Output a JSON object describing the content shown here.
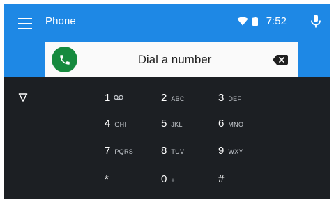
{
  "app": {
    "title": "Phone"
  },
  "status": {
    "time": "7:52",
    "icons": [
      "wifi-icon",
      "battery-icon"
    ]
  },
  "header": {
    "menu_icon": "menu-icon",
    "mic_icon": "mic-icon"
  },
  "dialer": {
    "prompt": "Dial a number",
    "call_icon": "phone-icon",
    "backspace_icon": "backspace-icon",
    "collapse_icon": "collapse-triangle-icon"
  },
  "keypad": {
    "rows": [
      [
        {
          "digit": "1",
          "letters": ""
        },
        {
          "digit": "2",
          "letters": "ABC"
        },
        {
          "digit": "3",
          "letters": "DEF"
        }
      ],
      [
        {
          "digit": "4",
          "letters": "GHI"
        },
        {
          "digit": "5",
          "letters": "JKL"
        },
        {
          "digit": "6",
          "letters": "MNO"
        }
      ],
      [
        {
          "digit": "7",
          "letters": "PQRS"
        },
        {
          "digit": "8",
          "letters": "TUV"
        },
        {
          "digit": "9",
          "letters": "WXY"
        }
      ],
      [
        {
          "digit": "*",
          "letters": ""
        },
        {
          "digit": "0",
          "letters": "+"
        },
        {
          "digit": "#",
          "letters": ""
        }
      ]
    ]
  },
  "colors": {
    "accent": "#1e88e5",
    "call": "#168a3e",
    "background": "#1c1f23"
  }
}
